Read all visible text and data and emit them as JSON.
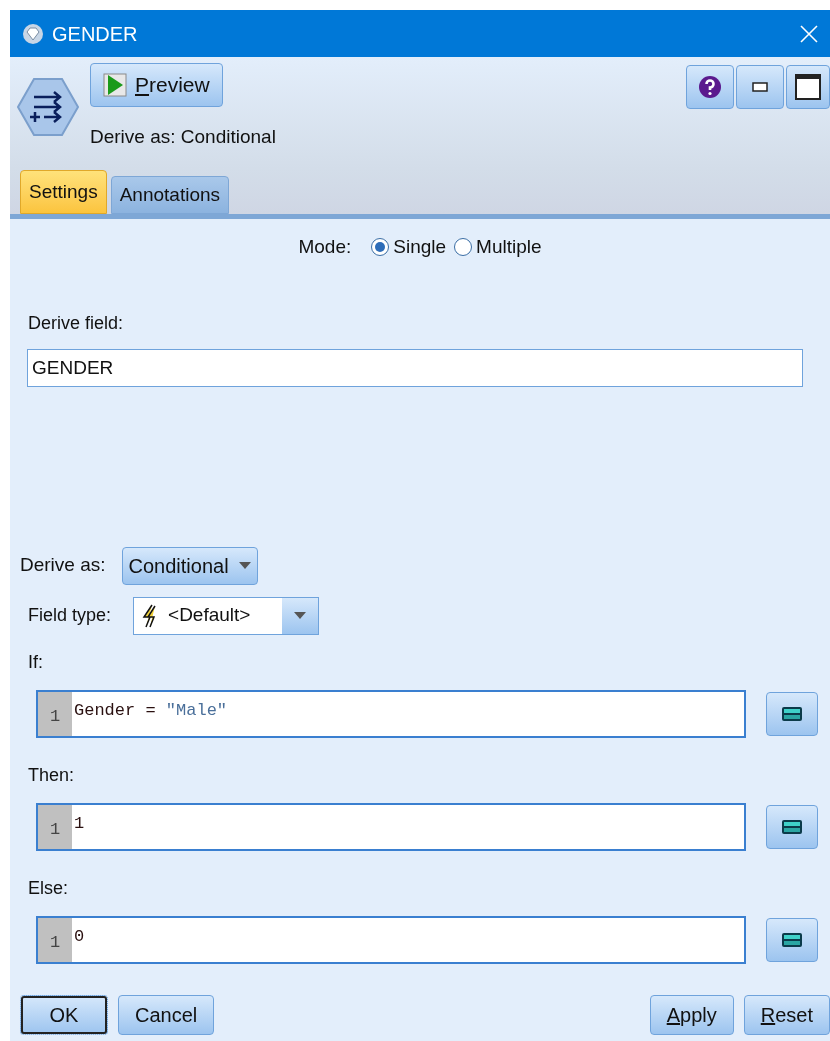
{
  "window": {
    "title": "GENDER"
  },
  "toolbar": {
    "preview_button": {
      "label": "Preview",
      "mnemonic": true
    },
    "subtitle": "Derive as: Conditional"
  },
  "tabs": [
    {
      "label": "Settings",
      "selected": true
    },
    {
      "label": "Annotations",
      "selected": false
    }
  ],
  "mode": {
    "label": "Mode:",
    "options": [
      {
        "label": "Single",
        "selected": true
      },
      {
        "label": "Multiple",
        "selected": false
      }
    ]
  },
  "derive_field": {
    "label": "Derive field:",
    "value": "GENDER"
  },
  "derive_as": {
    "label": "Derive as:",
    "value": "Conditional"
  },
  "field_type": {
    "label": "Field type:",
    "value": "<Default>"
  },
  "expressions": [
    {
      "label": "If:",
      "line_number": "1",
      "tokens": [
        {
          "text": "Gender = ",
          "kind": "plain"
        },
        {
          "text": "\"Male\"",
          "kind": "string"
        }
      ]
    },
    {
      "label": "Then:",
      "line_number": "1",
      "tokens": [
        {
          "text": "1",
          "kind": "plain"
        }
      ]
    },
    {
      "label": "Else:",
      "line_number": "1",
      "tokens": [
        {
          "text": "0",
          "kind": "plain"
        }
      ]
    }
  ],
  "buttons_left": [
    {
      "label": "OK",
      "mnemonic": false,
      "focused": true
    },
    {
      "label": "Cancel",
      "mnemonic": false,
      "focused": false
    }
  ],
  "buttons_right": [
    {
      "label": "Apply",
      "mnemonic": true,
      "focused": false
    },
    {
      "label": "Reset",
      "mnemonic": true,
      "focused": false
    }
  ]
}
